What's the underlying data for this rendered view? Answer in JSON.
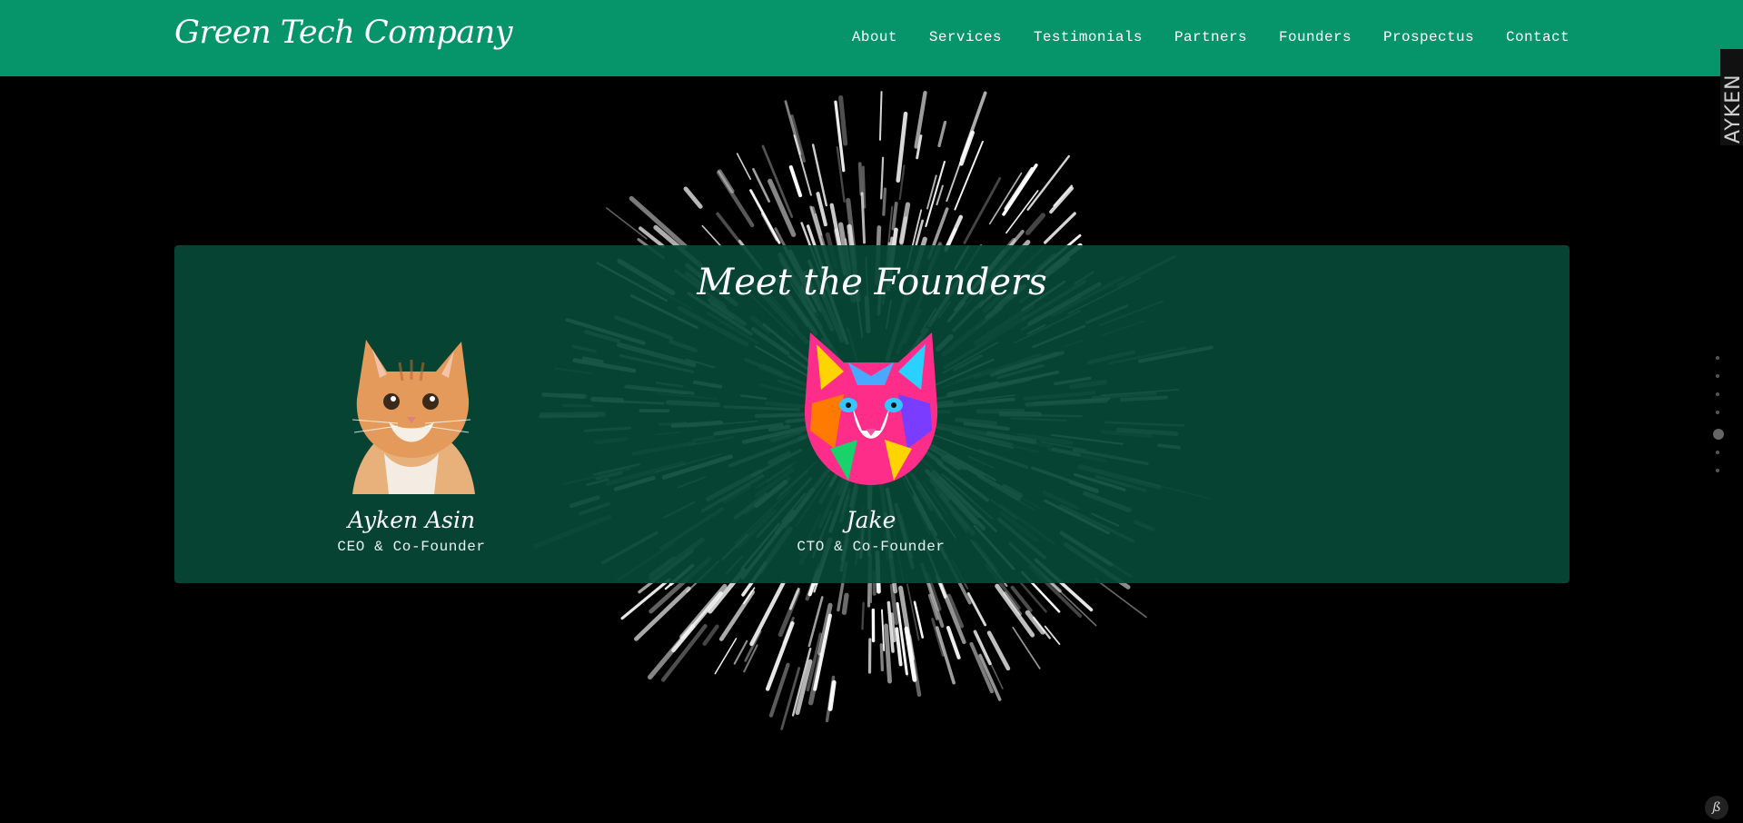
{
  "header": {
    "brand": "Green Tech Company",
    "nav": [
      "About",
      "Services",
      "Testimonials",
      "Partners",
      "Founders",
      "Prospectus",
      "Contact"
    ]
  },
  "founders_section": {
    "title": "Meet the Founders",
    "people": [
      {
        "name": "Ayken Asin",
        "role": "CEO & Co-Founder",
        "image": "orange-kitten-portrait"
      },
      {
        "name": "Jake",
        "role": "CTO & Co-Founder",
        "image": "colorful-cat-portrait"
      }
    ]
  },
  "side_tab": {
    "label": "AYKEN"
  },
  "page_dots": {
    "count": 7,
    "active_index": 4
  },
  "corner_logo": {
    "text": "ß"
  },
  "colors": {
    "header_bg": "#06946a",
    "panel_bg": "#084836",
    "page_bg": "#000000"
  }
}
